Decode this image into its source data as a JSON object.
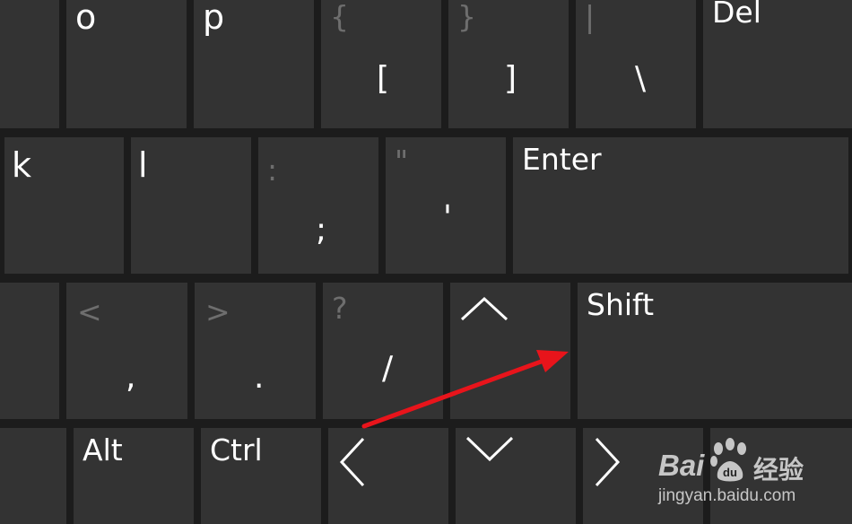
{
  "keyboard": {
    "row1": {
      "o": "o",
      "p": "p",
      "bracket_open_shift": "{",
      "bracket_open": "[",
      "bracket_close_shift": "}",
      "bracket_close": "]",
      "pipe": "|",
      "backslash": "\\",
      "del": "Del"
    },
    "row2": {
      "k": "k",
      "l": "l",
      "colon": ":",
      "semicolon": ";",
      "dquote": "\"",
      "quote": "'",
      "enter": "Enter"
    },
    "row3": {
      "lt": "<",
      "comma": ",",
      "gt": ">",
      "period": ".",
      "question": "?",
      "slash": "/",
      "shift": "Shift"
    },
    "row4": {
      "alt": "Alt",
      "ctrl": "Ctrl"
    }
  },
  "watermark": {
    "brand_left": "Bai",
    "brand_right": "经验",
    "url": "jingyan.baidu.com"
  },
  "colors": {
    "key_bg": "#333333",
    "gap": "#1c1c1c",
    "primary_text": "#ffffff",
    "secondary_text": "#6e6e6e",
    "annotation_arrow": "#e8141b"
  },
  "icons": [
    "up-arrow-icon",
    "left-arrow-icon",
    "down-arrow-icon",
    "right-arrow-icon",
    "annotation-arrow-icon",
    "baidu-paw-icon"
  ]
}
